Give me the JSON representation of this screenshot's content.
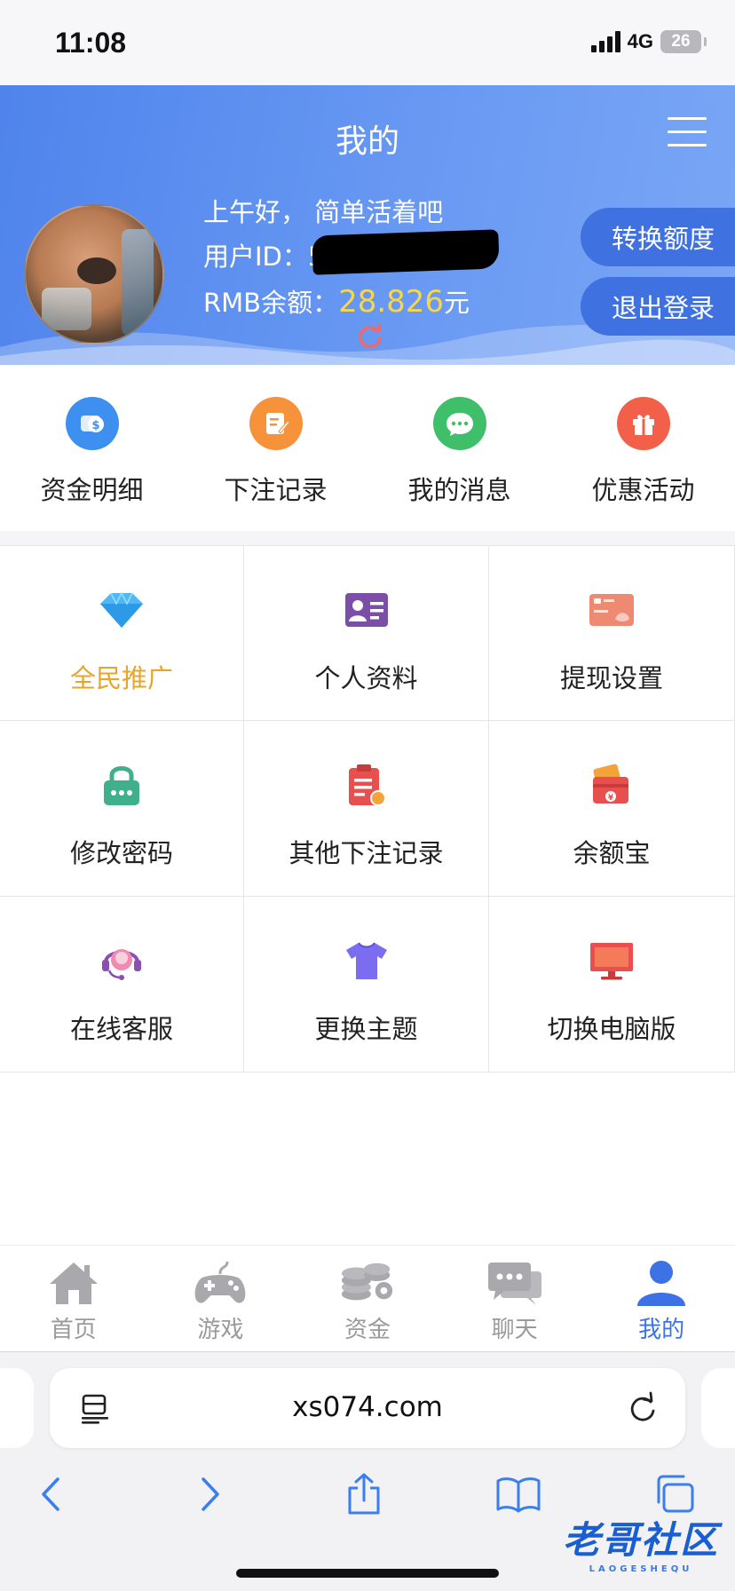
{
  "status_bar": {
    "time": "11:08",
    "network": "4G",
    "battery": "26"
  },
  "header": {
    "title": "我的",
    "greeting": "上午好，  简单活着吧",
    "user_id_label": "用户ID：5",
    "balance_label": "RMB余额：",
    "balance_amount": "28.826",
    "balance_unit": "元",
    "convert_button": "转换额度",
    "logout_button": "退出登录"
  },
  "quick_actions": [
    {
      "label": "资金明细",
      "icon": "coin-icon",
      "color": "#3d8ff0"
    },
    {
      "label": "下注记录",
      "icon": "edit-note-icon",
      "color": "#f5923a"
    },
    {
      "label": "我的消息",
      "icon": "chat-bubble-icon",
      "color": "#3fbf6a"
    },
    {
      "label": "优惠活动",
      "icon": "gift-icon",
      "color": "#f2604a"
    }
  ],
  "grid_items": [
    {
      "label": "全民推广",
      "icon": "diamond-icon",
      "highlight": true
    },
    {
      "label": "个人资料",
      "icon": "id-card-icon"
    },
    {
      "label": "提现设置",
      "icon": "bank-card-icon"
    },
    {
      "label": "修改密码",
      "icon": "lock-icon"
    },
    {
      "label": "其他下注记录",
      "icon": "clipboard-icon"
    },
    {
      "label": "余额宝",
      "icon": "wallet-icon"
    },
    {
      "label": "在线客服",
      "icon": "headset-icon"
    },
    {
      "label": "更换主题",
      "icon": "tshirt-icon"
    },
    {
      "label": "切换电脑版",
      "icon": "monitor-icon"
    }
  ],
  "bottom_nav": [
    {
      "label": "首页",
      "icon": "home-icon",
      "active": false
    },
    {
      "label": "游戏",
      "icon": "gamepad-icon",
      "active": false
    },
    {
      "label": "资金",
      "icon": "coins-icon",
      "active": false
    },
    {
      "label": "聊天",
      "icon": "chat-icon",
      "active": false
    },
    {
      "label": "我的",
      "icon": "user-icon",
      "active": true
    }
  ],
  "browser": {
    "url": "xs074.com"
  },
  "watermark": {
    "text": "老哥社区",
    "sub": "LAOGESHEQU"
  },
  "colors": {
    "accent": "#3d72e6",
    "balance": "#f7d54d",
    "highlight": "#e7a52b"
  }
}
